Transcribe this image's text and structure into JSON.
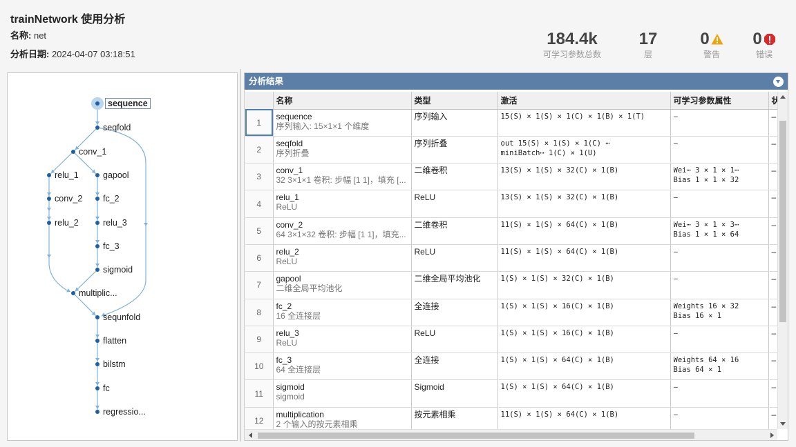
{
  "header": {
    "title": "trainNetwork 使用分析",
    "name_label": "名称:",
    "name_value": "net",
    "date_label": "分析日期:",
    "date_value": "2024-04-07 03:18:51"
  },
  "stats": [
    {
      "value": "184.4k",
      "label": "可学习参数总数"
    },
    {
      "value": "17",
      "label": "层"
    },
    {
      "value": "0",
      "label": "警告",
      "icon": "warning-icon",
      "color": "#f0a30a"
    },
    {
      "value": "0",
      "label": "错误",
      "icon": "error-icon",
      "color": "#d9292b"
    }
  ],
  "graph": {
    "nodes": [
      {
        "id": "sequence",
        "label": "sequence",
        "selected": true
      },
      {
        "id": "seqfold",
        "label": "seqfold"
      },
      {
        "id": "conv_1",
        "label": "conv_1"
      },
      {
        "id": "relu_1",
        "label": "relu_1"
      },
      {
        "id": "gapool",
        "label": "gapool"
      },
      {
        "id": "conv_2",
        "label": "conv_2"
      },
      {
        "id": "fc_2",
        "label": "fc_2"
      },
      {
        "id": "relu_2",
        "label": "relu_2"
      },
      {
        "id": "relu_3",
        "label": "relu_3"
      },
      {
        "id": "fc_3",
        "label": "fc_3"
      },
      {
        "id": "sigmoid",
        "label": "sigmoid"
      },
      {
        "id": "multiplication",
        "label": "multiplic..."
      },
      {
        "id": "sequnfold",
        "label": "sequnfold"
      },
      {
        "id": "flatten",
        "label": "flatten"
      },
      {
        "id": "bilstm",
        "label": "bilstm"
      },
      {
        "id": "fc",
        "label": "fc"
      },
      {
        "id": "regression",
        "label": "regressio..."
      }
    ]
  },
  "panel": {
    "title": "分析结果",
    "columns": [
      "",
      "名称",
      "类型",
      "激活",
      "可学习参数属性",
      "状"
    ],
    "rows": [
      {
        "idx": "1",
        "name": "sequence",
        "desc": "序列输入: 15×1×1 个维度",
        "type": "序列输入",
        "act1": "15(S) × 1(S) × 1(C) × 1(B) × 1(T)",
        "act2": "",
        "learn1": "–",
        "learn2": "",
        "state": "–"
      },
      {
        "idx": "2",
        "name": "seqfold",
        "desc": "序列折叠",
        "type": "序列折叠",
        "act1": "out         15(S) × 1(S) × 1(C) ⋯",
        "act2": "miniBatch⋯  1(C) × 1(U)",
        "learn1": "–",
        "learn2": "",
        "state": "–"
      },
      {
        "idx": "3",
        "name": "conv_1",
        "desc": "32 3×1×1 卷积: 步幅 [1 1]，填充 [...",
        "type": "二维卷积",
        "act1": "13(S) × 1(S) × 32(C) × 1(B)",
        "act2": "",
        "learn1": "Wei⋯  3 × 1 × 1⋯",
        "learn2": "Bias   1 × 1 × 32",
        "state": "–"
      },
      {
        "idx": "4",
        "name": "relu_1",
        "desc": "ReLU",
        "type": "ReLU",
        "act1": "13(S) × 1(S) × 32(C) × 1(B)",
        "act2": "",
        "learn1": "–",
        "learn2": "",
        "state": "–"
      },
      {
        "idx": "5",
        "name": "conv_2",
        "desc": "64 3×1×32 卷积: 步幅 [1 1]，填充...",
        "type": "二维卷积",
        "act1": "11(S) × 1(S) × 64(C) × 1(B)",
        "act2": "",
        "learn1": "Wei⋯  3 × 1 × 3⋯",
        "learn2": "Bias   1 × 1 × 64",
        "state": "–"
      },
      {
        "idx": "6",
        "name": "relu_2",
        "desc": "ReLU",
        "type": "ReLU",
        "act1": "11(S) × 1(S) × 64(C) × 1(B)",
        "act2": "",
        "learn1": "–",
        "learn2": "",
        "state": "–"
      },
      {
        "idx": "7",
        "name": "gapool",
        "desc": "二维全局平均池化",
        "type": "二维全局平均池化",
        "act1": "1(S) × 1(S) × 32(C) × 1(B)",
        "act2": "",
        "learn1": "–",
        "learn2": "",
        "state": "–"
      },
      {
        "idx": "8",
        "name": "fc_2",
        "desc": "16 全连接层",
        "type": "全连接",
        "act1": "1(S) × 1(S) × 16(C) × 1(B)",
        "act2": "",
        "learn1": "Weights  16 × 32",
        "learn2": "Bias     16 × 1",
        "state": "–"
      },
      {
        "idx": "9",
        "name": "relu_3",
        "desc": "ReLU",
        "type": "ReLU",
        "act1": "1(S) × 1(S) × 16(C) × 1(B)",
        "act2": "",
        "learn1": "–",
        "learn2": "",
        "state": "–"
      },
      {
        "idx": "10",
        "name": "fc_3",
        "desc": "64 全连接层",
        "type": "全连接",
        "act1": "1(S) × 1(S) × 64(C) × 1(B)",
        "act2": "",
        "learn1": "Weights  64 × 16",
        "learn2": "Bias     64 × 1",
        "state": "–"
      },
      {
        "idx": "11",
        "name": "sigmoid",
        "desc": "sigmoid",
        "type": "Sigmoid",
        "act1": "1(S) × 1(S) × 64(C) × 1(B)",
        "act2": "",
        "learn1": "–",
        "learn2": "",
        "state": "–"
      },
      {
        "idx": "12",
        "name": "multiplication",
        "desc": "2 个输入的按元素相乘",
        "type": "按元素相乘",
        "act1": "11(S) × 1(S) × 64(C) × 1(B)",
        "act2": "",
        "learn1": "–",
        "learn2": "",
        "state": "–"
      }
    ]
  },
  "colors": {
    "accent": "#5b7fa7",
    "graph_node": "#1f5fa0",
    "graph_edge": "#7fb3dc"
  }
}
